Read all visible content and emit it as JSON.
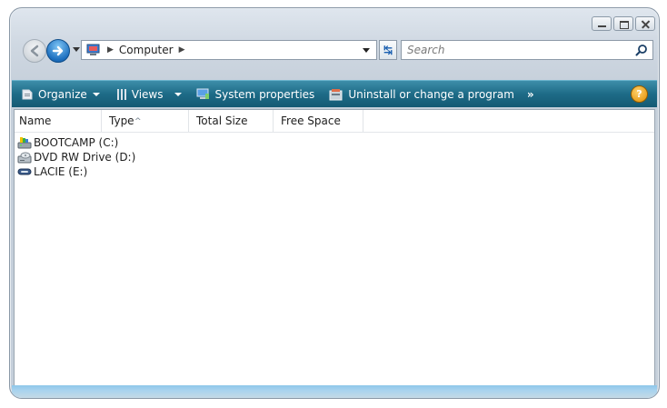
{
  "window": {
    "caption_buttons": [
      "minimize",
      "maximize",
      "close"
    ]
  },
  "nav": {
    "address_segments": [
      "Computer"
    ],
    "search_placeholder": "Search"
  },
  "commandbar": {
    "organize": "Organize",
    "views": "Views",
    "system_properties": "System properties",
    "uninstall": "Uninstall or change a program",
    "more": "»",
    "help": "?"
  },
  "columns": [
    "Name",
    "Type",
    "Total Size",
    "Free Space"
  ],
  "items": [
    {
      "label": "BOOTCAMP (C:)",
      "icon": "hard-drive-icon"
    },
    {
      "label": "DVD RW Drive (D:)",
      "icon": "dvd-drive-icon"
    },
    {
      "label": "LACIE (E:)",
      "icon": "removable-drive-icon"
    }
  ],
  "colors": {
    "commandbar_top": "#3d8ea9",
    "commandbar_bottom": "#145a74",
    "accent_blue": "#1d6fbf"
  }
}
